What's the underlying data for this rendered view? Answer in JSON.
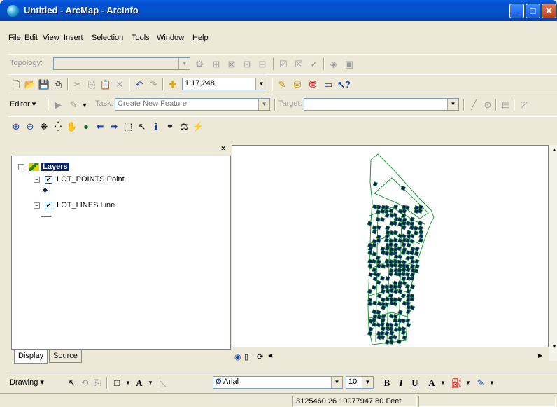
{
  "window": {
    "title": "Untitled - ArcMap - ArcInfo"
  },
  "menu": [
    "File",
    "Edit",
    "View",
    "Insert",
    "Selection",
    "Tools",
    "Window",
    "Help"
  ],
  "topology_toolbar": {
    "label": "Topology:"
  },
  "standard_toolbar": {
    "scale": "1:17,248"
  },
  "editor_toolbar": {
    "editor_label": "Editor",
    "task_label": "Task:",
    "task_value": "Create New Feature",
    "target_label": "Target:"
  },
  "toc": {
    "root": "Layers",
    "layers": [
      {
        "name": "LOT_POINTS Point",
        "checked": true,
        "symbol": "point"
      },
      {
        "name": "LOT_LINES Line",
        "checked": true,
        "symbol": "line"
      }
    ],
    "tabs": [
      "Display",
      "Source"
    ]
  },
  "drawing_toolbar": {
    "label": "Drawing",
    "font": "Arial",
    "font_size": "10"
  },
  "status": {
    "coordinates": "3125460.26  10077947.80 Feet"
  },
  "colors": {
    "points": "#0F1E5C",
    "lines": "#1A9A3A",
    "titlebar": "#0450D6"
  }
}
